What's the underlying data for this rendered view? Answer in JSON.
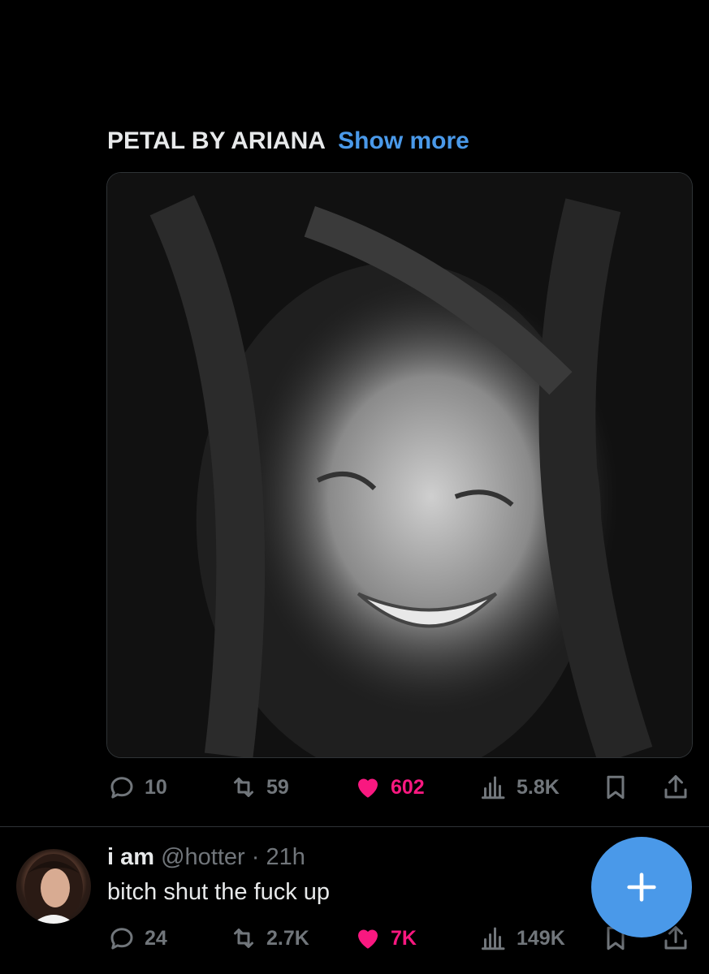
{
  "post": {
    "text": "PETAL BY ARIANA",
    "show_more": "Show more",
    "actions": {
      "replies": "10",
      "reposts": "59",
      "likes": "602",
      "views": "5.8K"
    }
  },
  "reply": {
    "name": "i am",
    "handle": "@hotter",
    "separator": " · ",
    "time": "21h",
    "text": "bitch shut the fuck up",
    "actions": {
      "replies": "24",
      "reposts": "2.7K",
      "likes": "7K",
      "views": "149K"
    }
  },
  "icons": {
    "reply": "speech-bubble-icon",
    "repost": "repost-arrows-icon",
    "like": "heart-icon",
    "views": "bar-chart-icon",
    "bookmark": "bookmark-icon",
    "share": "share-upload-icon",
    "compose": "plus-icon"
  },
  "colors": {
    "background": "#000000",
    "accent": "#4a99e9",
    "like": "#f91880",
    "muted": "#71767b",
    "text": "#e7e9ea"
  }
}
